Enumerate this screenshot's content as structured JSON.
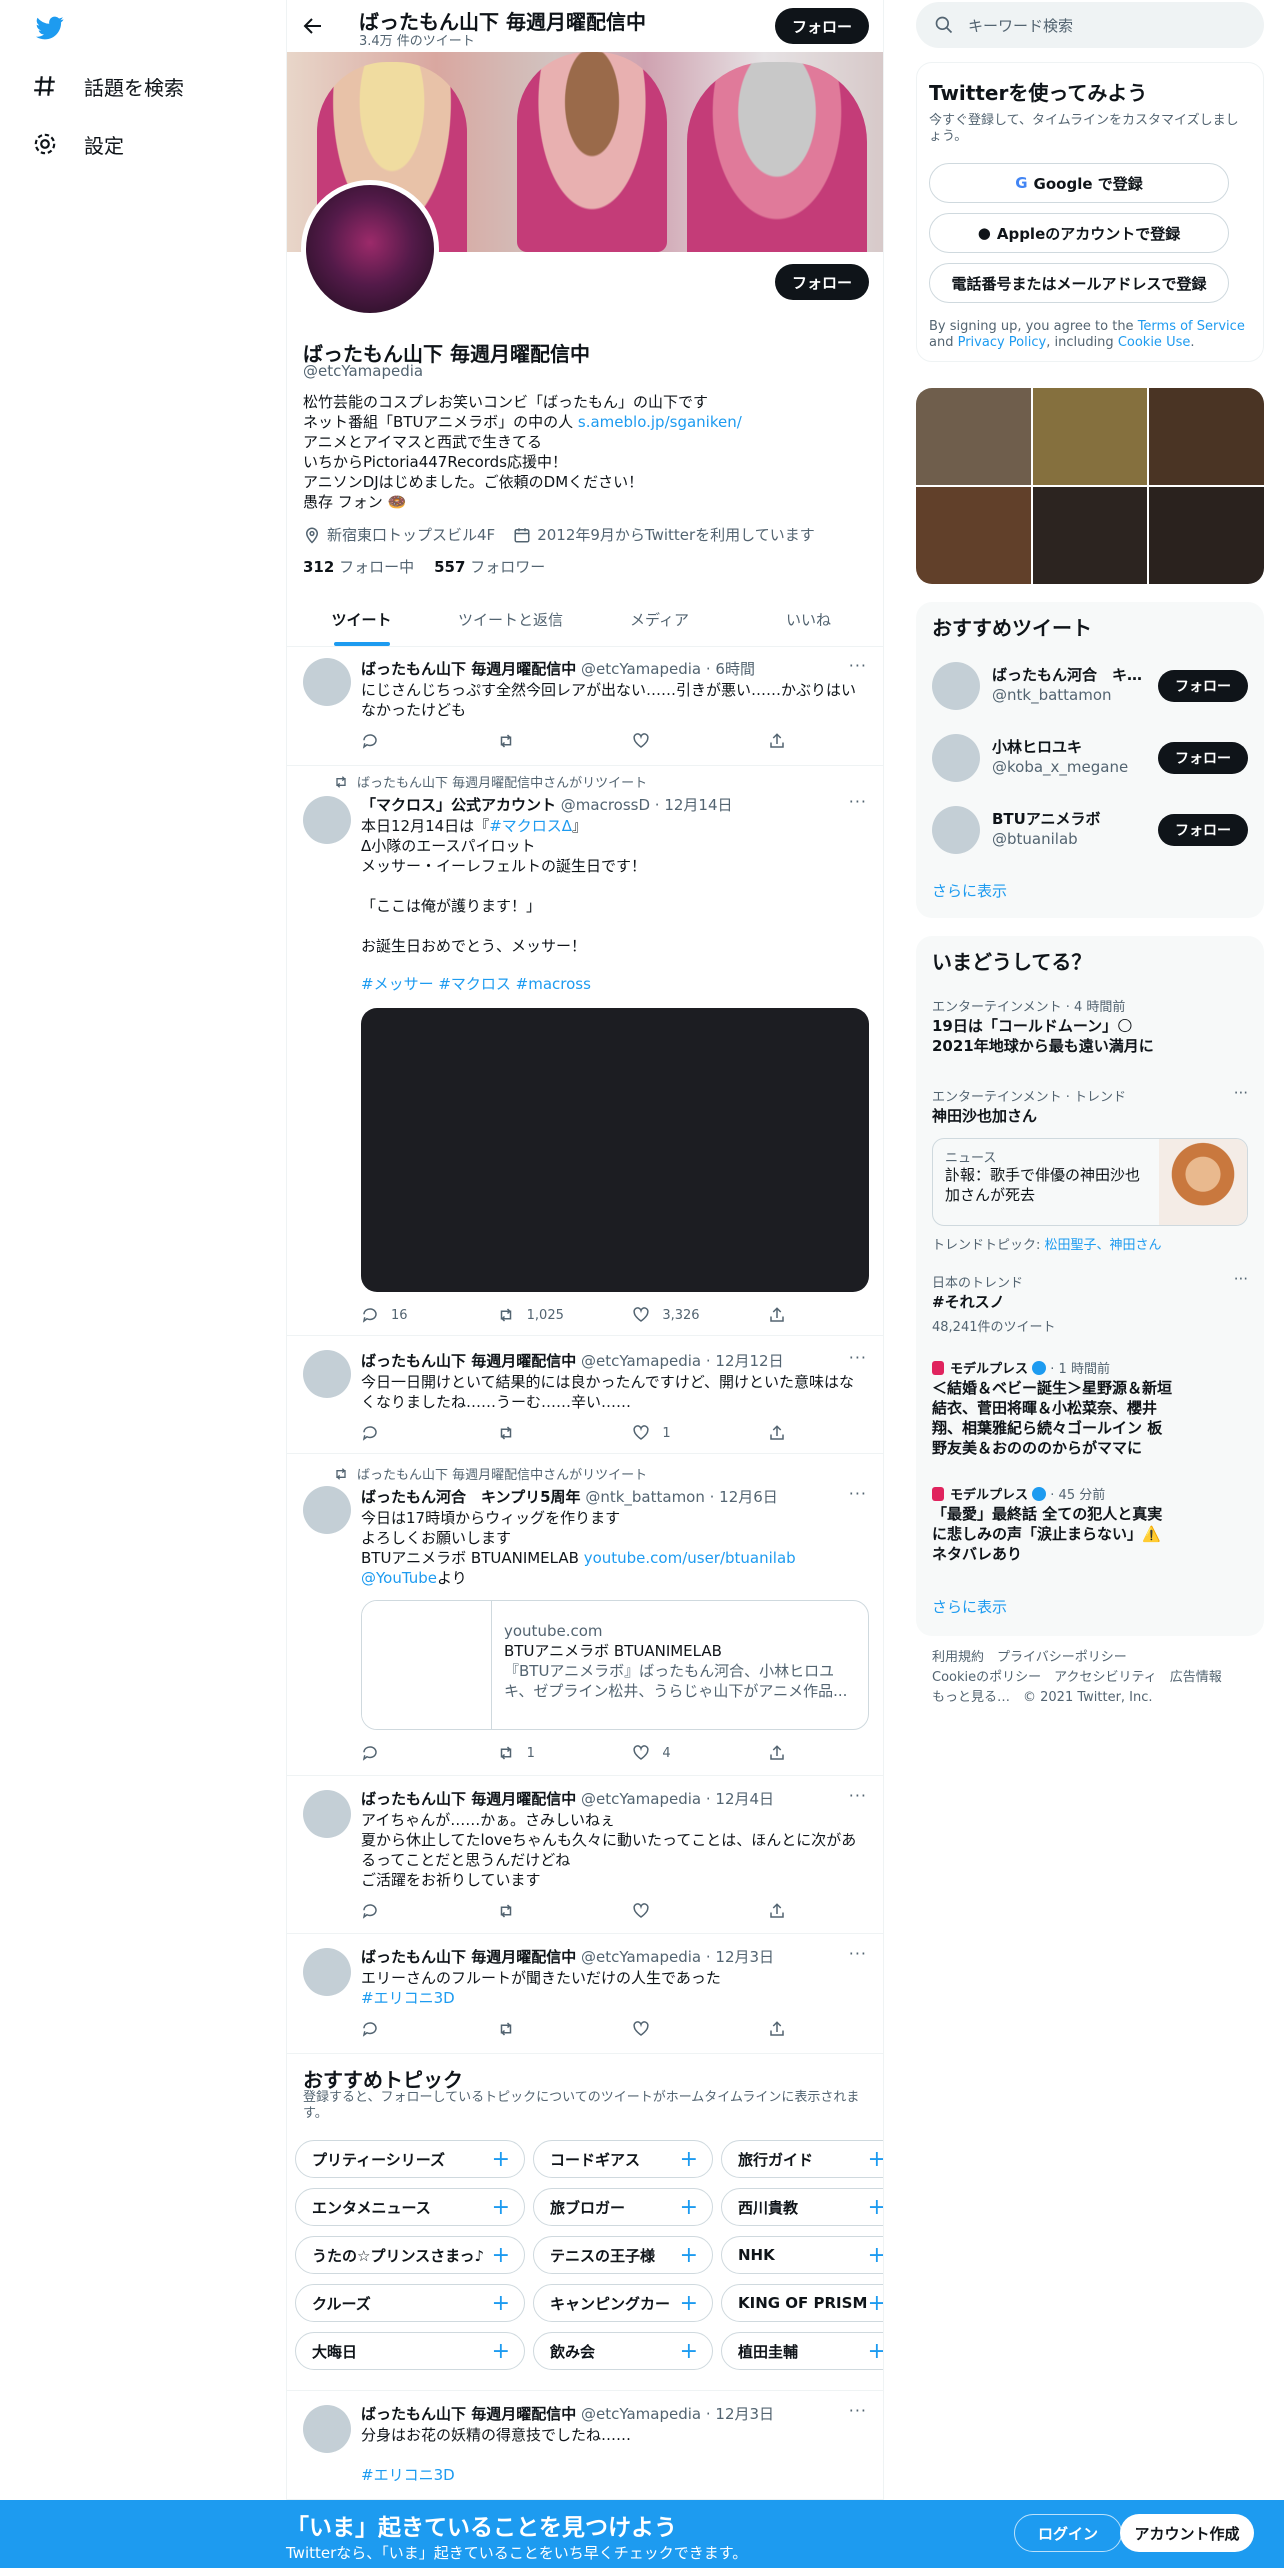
{
  "nav": {
    "explore": "話題を検索",
    "settings": "設定"
  },
  "header": {
    "name": "ばったもん山下 毎週月曜配信中",
    "tweet_count": "3.4万 件のツイート",
    "follow": "フォロー"
  },
  "profile": {
    "follow": "フォロー",
    "name": "ばったもん山下 毎週月曜配信中",
    "handle": "@etcYamapedia",
    "bio_1": "松竹芸能のコスプレお笑いコンビ「ばったもん」の山下です\nネット番組「BTUアニメラボ」の中の人 ",
    "bio_link": "s.ameblo.jp/sganiken/",
    "bio_2": "\nアニメとアイマスと西武で生きてる\nいちからPictoria447Records応援中！\nアニソンDJはじめました。ご依頼のDMください！\n愚存 フォン 🍩",
    "location": "新宿東口トップスビル4F",
    "joined": "2012年9月からTwitterを利用しています",
    "following_count": "312",
    "following_label": "フォロー中",
    "followers_count": "557",
    "followers_label": "フォロワー"
  },
  "tabs": [
    "ツイート",
    "ツイートと返信",
    "メディア",
    "いいね"
  ],
  "tweets": [
    {
      "name": "ばったもん山下 毎週月曜配信中",
      "meta": "@etcYamapedia · 6時間",
      "text": "にじさんじちっぷす全然今回レアが出ない……引きが悪い……かぶりはいなかったけども",
      "reply": "",
      "rt": "",
      "like": ""
    },
    {
      "rt_label": "ばったもん山下 毎週月曜配信中さんがリツイート",
      "name": "「マクロス」公式アカウント",
      "meta": "@macrossD · 12月14日",
      "text_1": "本日12月14日は『",
      "text_tag": "#マクロスΔ",
      "text_2": "』\nΔ小隊のエースパイロット\nメッサー・イーレフェルトの誕生日です！\n\n「ここは俺が護ります！」\n\nお誕生日おめでとう、メッサー！",
      "hashtags": "#メッサー #マクロス #macross",
      "reply": "16",
      "rt": "1,025",
      "like": "3,326"
    },
    {
      "name": "ばったもん山下 毎週月曜配信中",
      "meta": "@etcYamapedia · 12月12日",
      "text": "今日一日開けといて結果的には良かったんですけど、開けといた意味はなくなりましたね……うーむ……辛い……",
      "reply": "",
      "rt": "",
      "like": "1"
    },
    {
      "rt_label": "ばったもん山下 毎週月曜配信中さんがリツイート",
      "name": "ばったもん河合　キンプリ5周年",
      "meta": "@ntk_battamon · 12月6日",
      "text_1": "今日は17時頃からウィッグを作ります\nよろしくお願いします\nBTUアニメラボ BTUANIMELAB ",
      "link_1": "youtube.com/user/btuanilab",
      "link_2": " @YouTube",
      "text_2": "より",
      "card_domain": "youtube.com",
      "card_title": "BTUアニメラボ BTUANIMELAB",
      "card_desc": "『BTUアニメラボ』ばったもん河合、小林ヒロユキ、ゼプライン松井、うらじゃ山下がアニメ作品...",
      "reply": "",
      "rt": "1",
      "like": "4"
    },
    {
      "name": "ばったもん山下 毎週月曜配信中",
      "meta": "@etcYamapedia · 12月4日",
      "text": "アイちゃんが……かぁ。さみしいねぇ\n夏から休止してたloveちゃんも久々に動いたってことは、ほんとに次があるってことだと思うんだけどね\nご活躍をお祈りしています",
      "reply": "",
      "rt": "",
      "like": ""
    },
    {
      "name": "ばったもん山下 毎週月曜配信中",
      "meta": "@etcYamapedia · 12月3日",
      "text": "エリーさんのフルートが聞きたいだけの人生であった",
      "hashtag": "#エリコニ3D",
      "reply": "",
      "rt": "",
      "like": ""
    },
    {
      "name": "ばったもん山下 毎週月曜配信中",
      "meta": "@etcYamapedia · 12月3日",
      "text": "分身はお花の妖精の得意技でしたね……",
      "hashtag": "#エリコニ3D"
    }
  ],
  "topics": {
    "title": "おすすめトピック",
    "subtitle": "登録すると、フォローしているトピックについてのツイートがホームタイムラインに表示されます。",
    "chips": [
      [
        "プリティーシリーズ",
        "コードギアス",
        "旅行ガイド"
      ],
      [
        "エンタメニュース",
        "旅ブロガー",
        "西川貴教"
      ],
      [
        "うたの☆プリンスさまっ♪",
        "テニスの王子様",
        "NHK"
      ],
      [
        "クルーズ",
        "キャンピングカー",
        "KING OF PRISM"
      ],
      [
        "大晦日",
        "飲み会",
        "植田圭輔"
      ]
    ]
  },
  "search": {
    "placeholder": "キーワード検索"
  },
  "signup": {
    "title": "Twitterを使ってみよう",
    "subtitle": "今すぐ登録して、タイムラインをカスタマイズしましょう。",
    "google": "Google で登録",
    "apple": "Appleのアカウントで登録",
    "phone": "電話番号またはメールアドレスで登録",
    "terms_1": "By signing up, you agree to the ",
    "terms_link": "Terms of Service",
    "terms_2": " and ",
    "privacy_link": "Privacy Policy",
    "terms_3": ", including ",
    "cookie_link": "Cookie Use",
    "terms_4": "."
  },
  "who_to_follow": {
    "title": "おすすめツイート",
    "users": [
      {
        "name": "ばったもん河合　キ…",
        "handle": "@ntk_battamon",
        "button": "フォロー"
      },
      {
        "name": "小林ヒロユキ",
        "handle": "@koba_x_megane",
        "button": "フォロー"
      },
      {
        "name": "BTUアニメラボ",
        "handle": "@btuanilab",
        "button": "フォロー"
      }
    ],
    "more": "さらに表示"
  },
  "trends": {
    "title": "いまどうしてる？",
    "items": [
      {
        "category": "エンターテインメント · 4 時間前",
        "title": "19日は「コールドムーン」🌕2021年地球から最も遠い満月に"
      },
      {
        "category": "エンターテインメント · トレンド",
        "title": "神田沙也加さん",
        "news_label": "ニュース",
        "news_text": "訃報：歌手で俳優の神田沙也加さんが死去",
        "related_label": "トレンドトピック: ",
        "related": "松田聖子、神田さん"
      },
      {
        "category": "日本のトレンド",
        "title": "#それスノ",
        "count": "48,241件のツイート"
      },
      {
        "source": "モデルプレス",
        "time": " · 1 時間前",
        "title": "＜結婚＆ベビー誕生＞星野源＆新垣結衣、菅田将暉＆小松菜奈、櫻井翔、相葉雅紀ら続々ゴールイン 板野友美＆おのののからがママに"
      },
      {
        "source": "モデルプレス",
        "time": " · 45 分前",
        "title": "「最愛」最終話 全ての犯人と真実に悲しみの声「涙止まらない」⚠️ネタバレあり"
      }
    ],
    "more": "さらに表示"
  },
  "footer": {
    "line1": "利用規約　プライバシーポリシー",
    "line2": "Cookieのポリシー　アクセシビリティ　広告情報",
    "line3": "もっと見る…　© 2021 Twitter, Inc."
  },
  "bottom_bar": {
    "title": "「いま」起きていることを見つけよう",
    "subtitle": "Twitterなら、「いま」起きていることをいち早くチェックできます。",
    "login": "ログイン",
    "signup": "アカウント作成"
  },
  "colors": {
    "accent": "#1d9bf0",
    "text": "#0f1419",
    "muted": "#536471"
  }
}
